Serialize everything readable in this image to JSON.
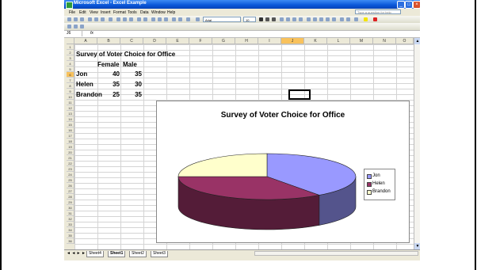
{
  "window": {
    "title": "Microsoft Excel - Excel Example"
  },
  "window_buttons": {
    "minimize": "_",
    "maximize": "□",
    "close": "×"
  },
  "menu": {
    "items": [
      "File",
      "Edit",
      "View",
      "Insert",
      "Format",
      "Tools",
      "Data",
      "Window",
      "Help"
    ],
    "help_placeholder": "Type a question for help"
  },
  "formatting_toolbar": {
    "font_name": "Arial",
    "font_size": "10"
  },
  "formula_bar": {
    "name_box": "J6",
    "fx_label": "fx"
  },
  "columns": [
    "A",
    "B",
    "C",
    "D",
    "E",
    "F",
    "G",
    "H",
    "I",
    "J",
    "K",
    "L",
    "M",
    "N",
    "O"
  ],
  "selected_column": "J",
  "rows": [
    "1",
    "2",
    "3",
    "4",
    "5",
    "6",
    "7",
    "8",
    "9",
    "10",
    "11",
    "12",
    "13",
    "14",
    "15",
    "16",
    "17",
    "18",
    "19",
    "20",
    "21",
    "22",
    "23",
    "24",
    "25",
    "26",
    "27",
    "28",
    "29",
    "30",
    "31",
    "32",
    "33",
    "34",
    "35",
    "36"
  ],
  "selected_row": "6",
  "cells": {
    "a1": "Survey of Voter Choice for Office",
    "b2": "Female",
    "c2": "Male",
    "a3": "Jon",
    "b3": "40",
    "c3": "35",
    "a4": "Helen",
    "b4": "35",
    "c4": "30",
    "a5": "Brandon",
    "b5": "25",
    "c5": "35"
  },
  "chart_data": {
    "type": "pie",
    "title": "Survey of Voter Choice for Office",
    "categories": [
      "Jon",
      "Helen",
      "Brandon"
    ],
    "values": [
      40,
      35,
      25
    ],
    "colors": [
      "#9999ff",
      "#993366",
      "#ffffcc"
    ],
    "legend": "right",
    "style": "3d"
  },
  "sheet_tabs": [
    "Sheet4",
    "Sheet1",
    "Sheet2",
    "Sheet3"
  ],
  "active_sheet": "Sheet1",
  "tab_nav": "◄ ◄ ► ►"
}
